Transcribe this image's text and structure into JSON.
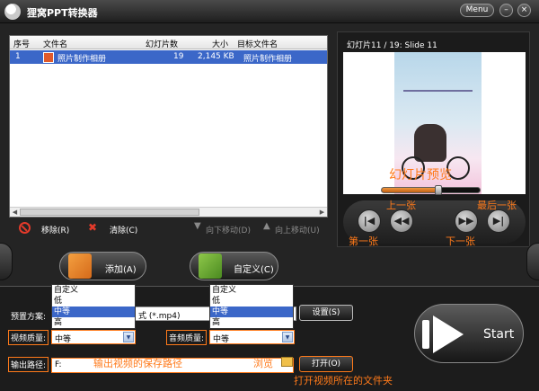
{
  "app": {
    "title": "狸窝PPT转换器",
    "menu_label": "Menu",
    "minimize_glyph": "–",
    "close_glyph": "×"
  },
  "file_list": {
    "columns": [
      "序号",
      "文件名",
      "幻灯片数",
      "大小",
      "目标文件名"
    ],
    "rows": [
      {
        "index": "1",
        "filename": "照片制作相册",
        "slides": "19",
        "size": "2,145 KB",
        "target": "照片制作相册"
      }
    ]
  },
  "list_toolbar": {
    "remove": "移除(R)",
    "clear": "清除(C)",
    "move_down": "向下移动(D)",
    "move_up": "向上移动(U)"
  },
  "preview": {
    "label": "幻灯片11 / 19: Slide 11",
    "progress": 0.58,
    "nav": {
      "first": "|◀",
      "prev": "◀◀",
      "next": "▶▶",
      "last": "▶|"
    }
  },
  "annotations": {
    "preview": "幻灯片预览",
    "prev": "上一张",
    "last": "最后一张",
    "first": "第一张",
    "next": "下一张",
    "output_path": "输出视频的保存路径",
    "open_folder": "打开视频所在的文件夹"
  },
  "buttons": {
    "add": "添加(A)",
    "custom": "自定义(C)",
    "settings": "设置(S)",
    "browse": "浏览",
    "open": "打开(O)",
    "start": "Start"
  },
  "settings": {
    "preset_label": "预置方案:",
    "preset_value": "式 (*.mp4)",
    "video_quality_label": "视频质量:",
    "video_quality": "中等",
    "audio_quality_label": "音频质量:",
    "audio_quality": "中等",
    "output_label": "输出路径:",
    "output_value": "F:",
    "quality_options": [
      "自定义",
      "低",
      "中等",
      "高"
    ],
    "selected_option": "中等"
  },
  "colors": {
    "accent_orange": "#ff7a1a",
    "selection_blue": "#3b67c8",
    "background": "#242424"
  }
}
